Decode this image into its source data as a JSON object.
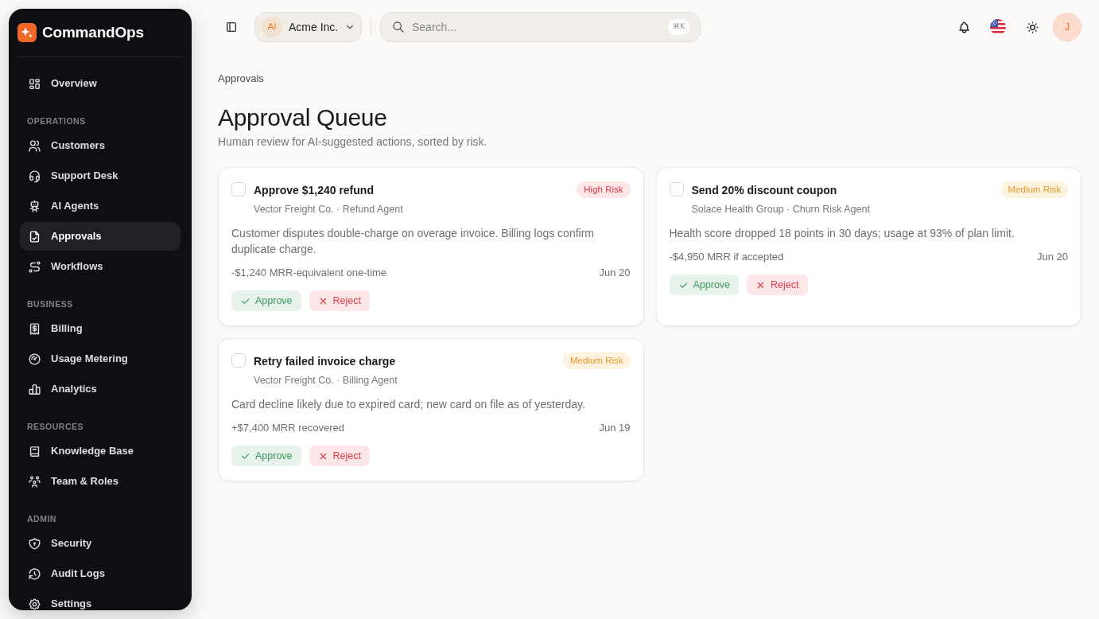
{
  "sidebar": {
    "brand": "CommandOps",
    "sections": [
      {
        "items": [
          {
            "label": "Overview",
            "selected": false
          }
        ]
      },
      {
        "heading": "OPERATIONS",
        "items": [
          {
            "label": "Customers",
            "selected": false
          },
          {
            "label": "Support Desk",
            "selected": false
          },
          {
            "label": "AI Agents",
            "selected": false
          },
          {
            "label": "Approvals",
            "selected": true
          },
          {
            "label": "Workflows",
            "selected": false
          }
        ]
      },
      {
        "heading": "BUSINESS",
        "items": [
          {
            "label": "Billing",
            "selected": false
          },
          {
            "label": "Usage Metering",
            "selected": false
          },
          {
            "label": "Analytics",
            "selected": false
          }
        ]
      },
      {
        "heading": "RESOURCES",
        "items": [
          {
            "label": "Knowledge Base",
            "selected": false
          },
          {
            "label": "Team & Roles",
            "selected": false
          }
        ]
      },
      {
        "heading": "ADMIN",
        "items": [
          {
            "label": "Security",
            "selected": false
          },
          {
            "label": "Audit Logs",
            "selected": false
          },
          {
            "label": "Settings",
            "selected": false
          }
        ]
      }
    ]
  },
  "topbar": {
    "org": {
      "initials": "AI",
      "name": "Acme Inc."
    },
    "search": {
      "placeholder": "Search...",
      "shortcut": "⌘K"
    },
    "avatar": "J"
  },
  "breadcrumb": "Approvals",
  "title": "Approval Queue",
  "subtitle": "Human review for AI-suggested actions, sorted by risk.",
  "approvals": [
    {
      "checked": false,
      "title": "Approve $1,240 refund",
      "meta": "Vector Freight Co. · Refund Agent",
      "risk": {
        "label": "High Risk",
        "kind": "high"
      },
      "description": "Customer disputes double-charge on overage invoice. Billing logs confirm duplicate charge.",
      "impact": "-$1,240 MRR-equivalent one-time",
      "date": "Jun 20",
      "actions": [
        {
          "label": "Approve",
          "kind": "approve"
        },
        {
          "label": "Reject",
          "kind": "reject"
        }
      ]
    },
    {
      "checked": false,
      "title": "Send 20% discount coupon",
      "meta": "Solace Health Group · Churn Risk Agent",
      "risk": {
        "label": "Medium Risk",
        "kind": "medium"
      },
      "description": "Health score dropped 18 points in 30 days; usage at 93% of plan limit.",
      "impact": "-$4,950 MRR if accepted",
      "date": "Jun 20",
      "actions": [
        {
          "label": "Approve",
          "kind": "approve"
        },
        {
          "label": "Reject",
          "kind": "reject"
        }
      ]
    },
    {
      "checked": false,
      "title": "Retry failed invoice charge",
      "meta": "Vector Freight Co. · Billing Agent",
      "risk": {
        "label": "Medium Risk",
        "kind": "medium"
      },
      "description": "Card decline likely due to expired card; new card on file as of yesterday.",
      "impact": "+$7,400 MRR recovered",
      "date": "Jun 19",
      "actions": [
        {
          "label": "Approve",
          "kind": "approve"
        },
        {
          "label": "Reject",
          "kind": "reject"
        }
      ]
    }
  ]
}
